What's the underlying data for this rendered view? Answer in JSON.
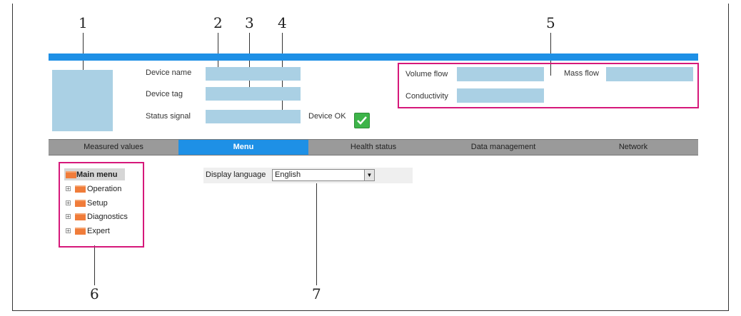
{
  "callouts": [
    "1",
    "2",
    "3",
    "4",
    "5",
    "6",
    "7"
  ],
  "header": {
    "fields": {
      "device_name": "Device name",
      "device_tag": "Device tag",
      "status_signal": "Status signal",
      "device_ok": "Device OK"
    },
    "measurements": {
      "volume_flow": "Volume flow",
      "mass_flow": "Mass flow",
      "conductivity": "Conductivity"
    }
  },
  "nav": {
    "items": [
      "Measured values",
      "Menu",
      "Health status",
      "Data management",
      "Network"
    ],
    "active": "Menu"
  },
  "tree": {
    "root": "Main menu",
    "items": [
      "Operation",
      "Setup",
      "Diagnostics",
      "Expert"
    ]
  },
  "language": {
    "label": "Display language",
    "value": "English"
  },
  "icons": {
    "status": "checkmark-icon",
    "folder": "folder-icon",
    "dropdown": "chevron-down-icon"
  },
  "colors": {
    "accent": "#1e90e6",
    "highlight": "#d6187a",
    "placeholder": "#aad0e4",
    "ok": "#3db449"
  }
}
